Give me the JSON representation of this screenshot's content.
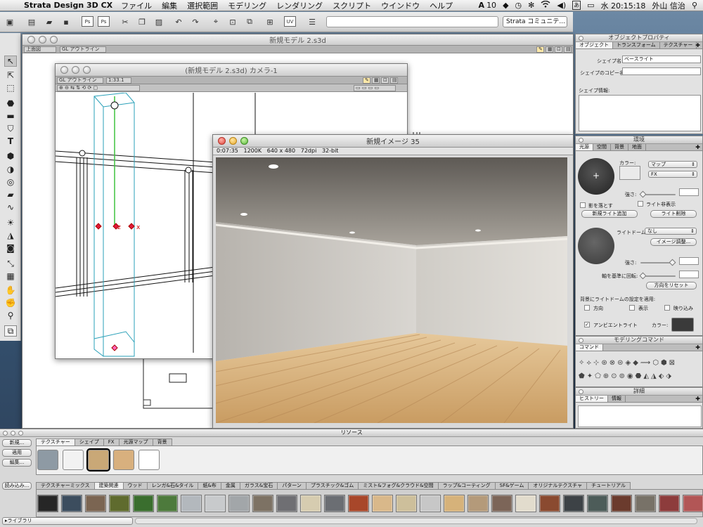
{
  "menubar": {
    "app_name": "Strata Design 3D CX",
    "items": [
      "ファイル",
      "編集",
      "選択範囲",
      "モデリング",
      "レンダリング",
      "スクリプト",
      "ウインドウ",
      "ヘルプ"
    ],
    "status_number": "10",
    "clock": "水 20:15:18",
    "user": "外山 信治"
  },
  "toolbar": {
    "community_select": "Strata コミュニテ..."
  },
  "main_window": {
    "title": "新規モデル 2.s3d",
    "mode_select": "上面図",
    "render_select": "GL アウトライン"
  },
  "camera_window": {
    "title": "(新規モデル 2.s3d) カメラ-1",
    "render_select": "GL アウトライン",
    "scale": "1:33.1"
  },
  "render_window": {
    "title": "新規イメージ 35",
    "status": {
      "time": "0:07:35",
      "memory": "1200K",
      "size": "640 x 480",
      "dpi": "72dpi",
      "depth": "32-bit"
    }
  },
  "object_props": {
    "title": "オブジェクトプロパティ",
    "tabs": [
      "オブジェクト",
      "トランスフォーム",
      "テクスチャー"
    ],
    "shape_name_label": "シェイプ名:",
    "shape_name_value": "ベースライト",
    "shape_copy_label": "シェイプのコピー名:",
    "shape_info_label": "シェイプ情報:"
  },
  "environment": {
    "title": "環境",
    "tabs": [
      "光源",
      "空間",
      "背景",
      "地面"
    ],
    "color_label": "カラー:",
    "map_select": "マップ",
    "fx_select": "FX",
    "strength_label": "強さ:",
    "cast_shadow_label": "影を落とす",
    "hide_light_label": "ライト非表示",
    "add_light_button": "新規ライト追加",
    "delete_light_button": "ライト削除",
    "light_dome_label": "ライトドーム:",
    "light_dome_select": "なし",
    "image_adjust_button": "イメージ調整...",
    "strength2_label": "強さ:",
    "rotate_label": "軸を基準に回転:",
    "reset_direction_button": "方向をリセット",
    "apply_bg_label": "背景にライトドームの設定を適用:",
    "direction_label": "方向",
    "display_label": "表示",
    "reflect_label": "映り込み",
    "ambient_label": "アンビエントライト",
    "ambient_color_label": "カラー:"
  },
  "modeling_commands": {
    "title": "モデリングコマンド",
    "tabs": [
      "コマンド"
    ]
  },
  "details": {
    "title": "詳細",
    "tabs": [
      "ヒストリー",
      "情報"
    ]
  },
  "resources": {
    "title": "リソース",
    "new_button": "新規...",
    "apply_button": "適用",
    "edit_button": "編集...",
    "load_button": "読み込み...",
    "tabs": [
      "テクスチャー",
      "シェイプ",
      "FX",
      "光源マップ",
      "背景"
    ],
    "library_tabs": [
      "テクスチャーミックス",
      "建築関連",
      "ウッド",
      "レンガ&石&タイル",
      "紙&布",
      "金属",
      "ガラス&宝石",
      "パターン",
      "プラスチック&ゴム",
      "ミスト&フォグ&クラウド&空間",
      "ラップ&コーティング",
      "SF&ゲーム",
      "オリジナルテクスチャ",
      "チュートリアル"
    ],
    "library_select": "▸ライブラリ",
    "recent_colors": [
      "#8e9aa4",
      "#f2f2f2",
      "#c9a877",
      "#d8b07e",
      "#ffffff"
    ],
    "swatch_colors": [
      "#262626",
      "#3c4d5e",
      "#7b6552",
      "#5f6b2e",
      "#3a6e2e",
      "#4d7a3c",
      "#b3b8bd",
      "#c8cacc",
      "#a2a6a9",
      "#7d7264",
      "#6f6f73",
      "#d6ccb0",
      "#6b6e73",
      "#a8472a",
      "#d9b88a",
      "#cdbf9b",
      "#c7c7c7",
      "#d6b27a",
      "#b49a7a",
      "#7c6558",
      "#e2dccd",
      "#8a4a30",
      "#3d4246",
      "#4d5c59",
      "#6b3b2d",
      "#787268",
      "#8d3c3c",
      "#b25656"
    ]
  },
  "colors": {
    "accent": "#3a6fd8",
    "panel": "#e2e2e2"
  }
}
